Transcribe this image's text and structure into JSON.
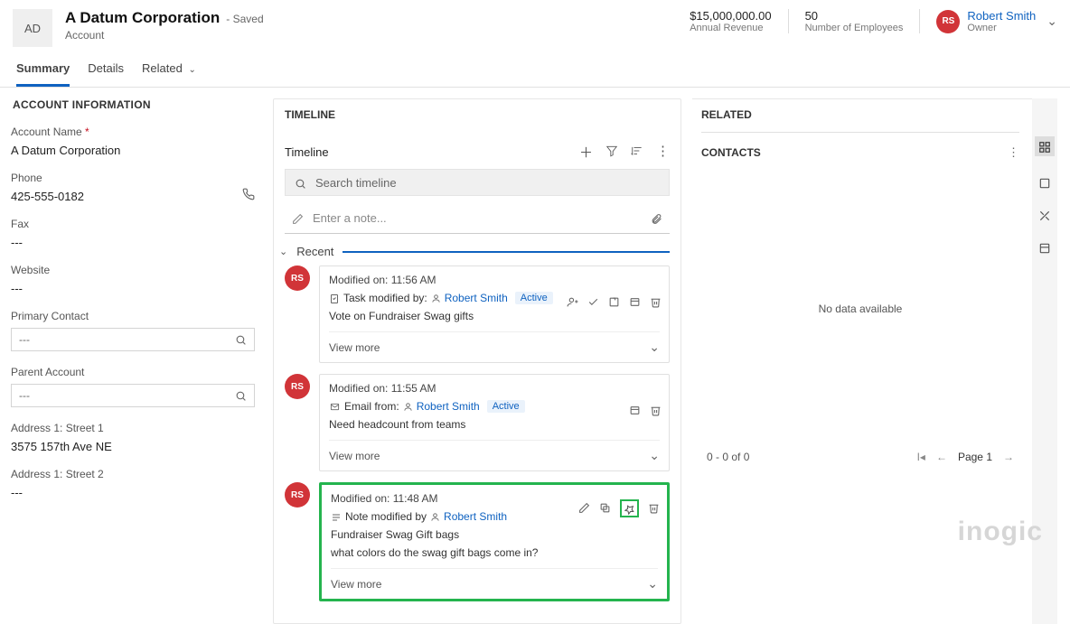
{
  "header": {
    "logo_initials": "AD",
    "title": "A Datum Corporation",
    "saved_suffix": "- Saved",
    "entity": "Account",
    "revenue_value": "$15,000,000.00",
    "revenue_label": "Annual Revenue",
    "employees_value": "50",
    "employees_label": "Number of Employees",
    "owner_initials": "RS",
    "owner_name": "Robert Smith",
    "owner_label": "Owner"
  },
  "tabs": {
    "summary": "Summary",
    "details": "Details",
    "related": "Related"
  },
  "left": {
    "section": "ACCOUNT INFORMATION",
    "account_name_lbl": "Account Name",
    "account_name_val": "A Datum Corporation",
    "phone_lbl": "Phone",
    "phone_val": "425-555-0182",
    "fax_lbl": "Fax",
    "fax_val": "---",
    "website_lbl": "Website",
    "website_val": "---",
    "primary_contact_lbl": "Primary Contact",
    "primary_contact_placeholder": "---",
    "parent_account_lbl": "Parent Account",
    "parent_account_placeholder": "---",
    "street1_lbl": "Address 1: Street 1",
    "street1_val": "3575 157th Ave NE",
    "street2_lbl": "Address 1: Street 2",
    "street2_val": "---"
  },
  "timeline": {
    "section": "TIMELINE",
    "title": "Timeline",
    "search_placeholder": "Search timeline",
    "note_placeholder": "Enter a note...",
    "recent_label": "Recent",
    "view_more": "View more",
    "cards": [
      {
        "avatar": "RS",
        "modified": "Modified on: 11:56 AM",
        "type_prefix": "Task modified by:",
        "user": "Robert Smith",
        "status": "Active",
        "text1": "Vote on Fundraiser Swag gifts"
      },
      {
        "avatar": "RS",
        "modified": "Modified on: 11:55 AM",
        "type_prefix": "Email from:",
        "user": "Robert Smith",
        "status": "Active",
        "text1": "Need headcount from teams"
      },
      {
        "avatar": "RS",
        "modified": "Modified on: 11:48 AM",
        "type_prefix": "Note modified by",
        "user": "Robert Smith",
        "text1": "Fundraiser Swag Gift bags",
        "text2": "what colors do the swag gift bags come in?"
      }
    ]
  },
  "related": {
    "section": "RELATED",
    "contacts_label": "CONTACTS",
    "no_data": "No data available",
    "pager_count": "0 - 0 of 0",
    "pager_page": "Page 1"
  },
  "watermark": "inogic"
}
